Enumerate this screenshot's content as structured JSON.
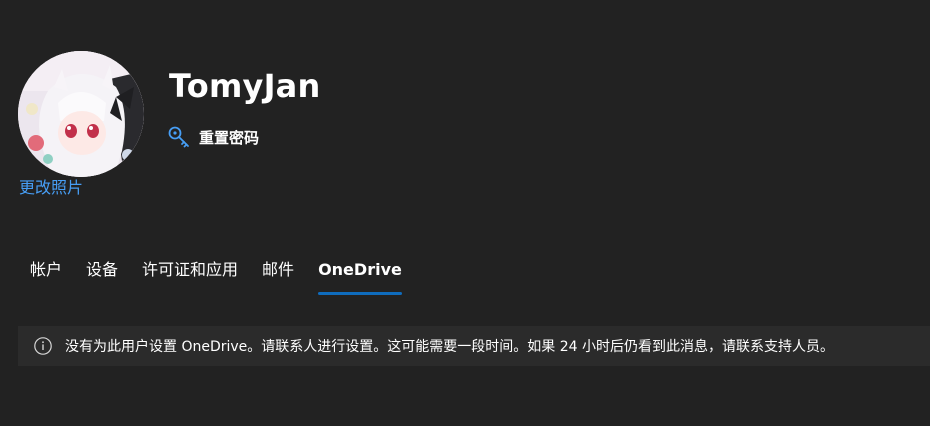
{
  "profile": {
    "user_name": "TomyJan",
    "reset_password_label": "重置密码",
    "change_photo_label": "更改照片"
  },
  "tabs": [
    {
      "label": "帐户",
      "active": false
    },
    {
      "label": "设备",
      "active": false
    },
    {
      "label": "许可证和应用",
      "active": false
    },
    {
      "label": "邮件",
      "active": false
    },
    {
      "label": "OneDrive",
      "active": true
    }
  ],
  "info_banner": {
    "message": "没有为此用户设置 OneDrive。请联系人进行设置。这可能需要一段时间。如果 24 小时后仍看到此消息，请联系支持人员。"
  },
  "colors": {
    "background": "#222222",
    "banner_background": "#2b2b2b",
    "link": "#479ef5",
    "tab_indicator": "#0f6cbd"
  },
  "icons": {
    "reset_password": "key-icon",
    "banner": "info-icon"
  }
}
